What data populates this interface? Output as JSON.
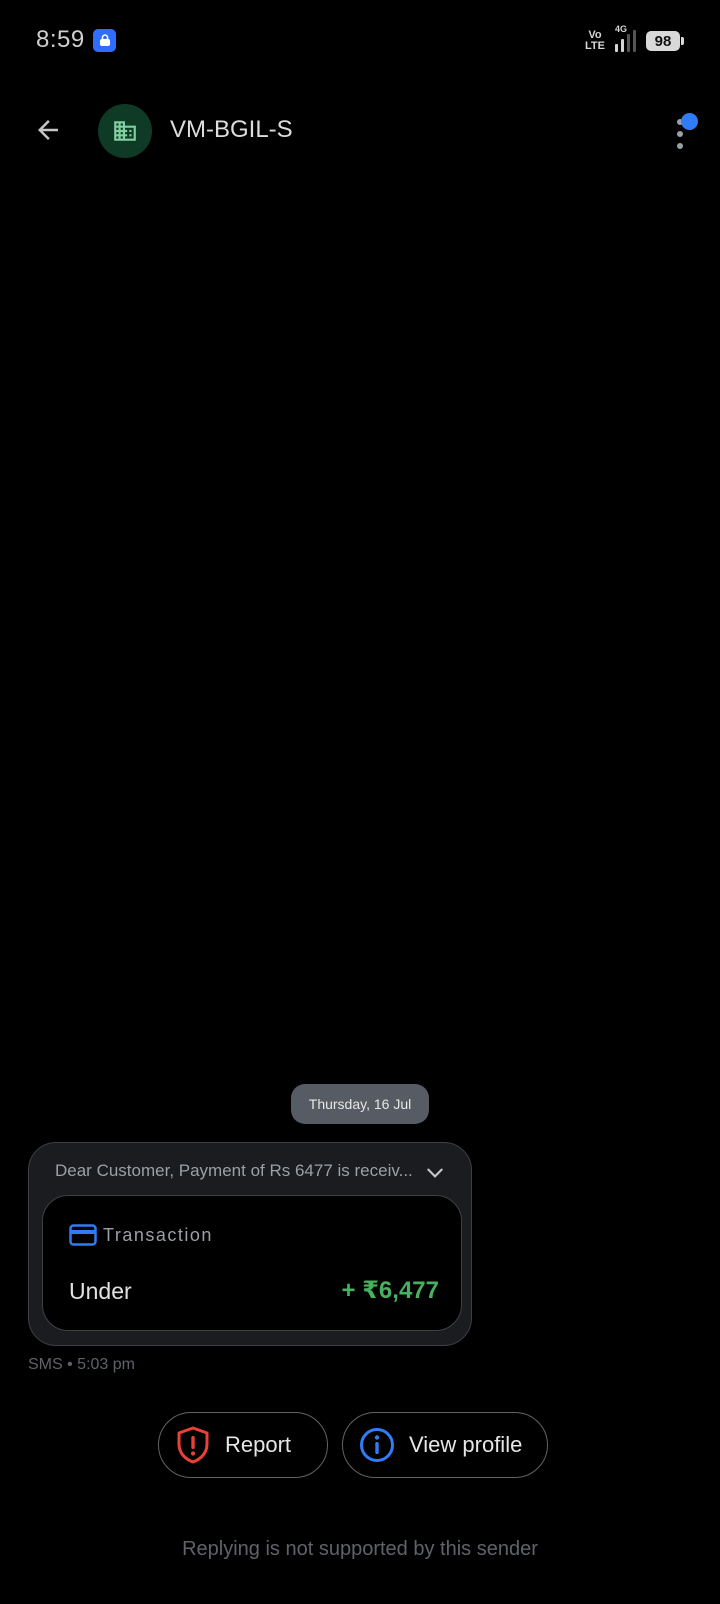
{
  "status_bar": {
    "time": "8:59",
    "volte_top": "Vo",
    "volte_bottom": "LTE",
    "network": "4G",
    "battery": "98"
  },
  "header": {
    "contact_name": "VM-BGIL-S"
  },
  "conversation": {
    "date_chip": "Thursday, 16 Jul",
    "message": {
      "preview": "Dear Customer, Payment of Rs 6477 is receiv...",
      "card_label": "Transaction",
      "description": "Under",
      "amount": "+ ₹6,477",
      "meta": "SMS • 5:03 pm"
    }
  },
  "actions": {
    "report_label": "Report",
    "view_profile_label": "View profile"
  },
  "footer": {
    "reply_note": "Replying is not supported by this sender"
  },
  "colors": {
    "accent_blue": "#2f7cf6",
    "report_red": "#e94235",
    "amount_green": "#46b25f",
    "avatar_bg": "#0f3a26"
  }
}
